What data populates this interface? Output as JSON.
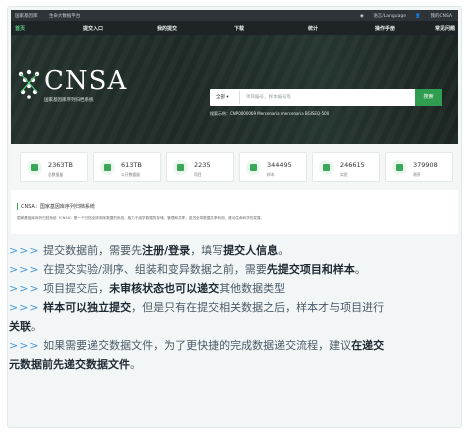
{
  "topbar": {
    "left": [
      "国家基因库",
      "生命大数据平台"
    ],
    "right": [
      "语言/Language",
      "我的CNSA"
    ]
  },
  "nav": {
    "items": [
      {
        "label": "首页",
        "active": true
      },
      {
        "label": "提交入口",
        "active": false
      },
      {
        "label": "我的提交",
        "active": false
      },
      {
        "label": "下载",
        "active": false
      },
      {
        "label": "统计",
        "active": false
      },
      {
        "label": "操作手册",
        "active": false
      },
      {
        "label": "常见问题",
        "active": false
      }
    ]
  },
  "hero": {
    "logo": "CNSA",
    "logo_sub": "国家基因库序列归档系统",
    "search_scope": "全部",
    "search_placeholder": "项目编号，样本编号等",
    "search_button": "搜索",
    "examples": "搜索示例：CNP0000069 Mercenaria mercenaria BGISEQ-500"
  },
  "stats": [
    {
      "value": "2363TB",
      "label": "总数据量"
    },
    {
      "value": "613TB",
      "label": "公开数据量"
    },
    {
      "value": "2235",
      "label": "项目"
    },
    {
      "value": "344495",
      "label": "样本"
    },
    {
      "value": "246615",
      "label": "实验"
    },
    {
      "value": "379908",
      "label": "测序"
    }
  ],
  "intro": {
    "title": "CNSA：国家基因库序列归档系统",
    "desc": "国家基因库序列归档系统（CNSA）是一个归档全球测序数据的系统，致力于组学数据的存储、管理和共享，促进全球数据共享利用，推动生命科学的发展。"
  },
  "notes": {
    "prefix": ">>>",
    "l1_a": "提交数据前，需要先",
    "l1_b": "注册/登录",
    "l1_c": "，填写",
    "l1_d": "提交人信息",
    "l1_e": "。",
    "l2_a": "在提交实验/测序、组装和变异数据之前，需要",
    "l2_b": "先提交项目和样本",
    "l2_c": "。",
    "l3_a": "项目提交后，",
    "l3_b": "未审核状态也可以递交",
    "l3_c": "其他数据类型",
    "l4_b": "样本可以独立提交",
    "l4_c": "，但是只有在提交相关数据之后，样本才与项目进行",
    "l4_d": "关联",
    "l4_e": "。",
    "l5_a": "如果需要递交数据文件，为了更快捷的完成数据递交流程，建议",
    "l5_b": "在递交",
    "l5_c": "元数据前先递交数据文件",
    "l5_d": "。"
  }
}
